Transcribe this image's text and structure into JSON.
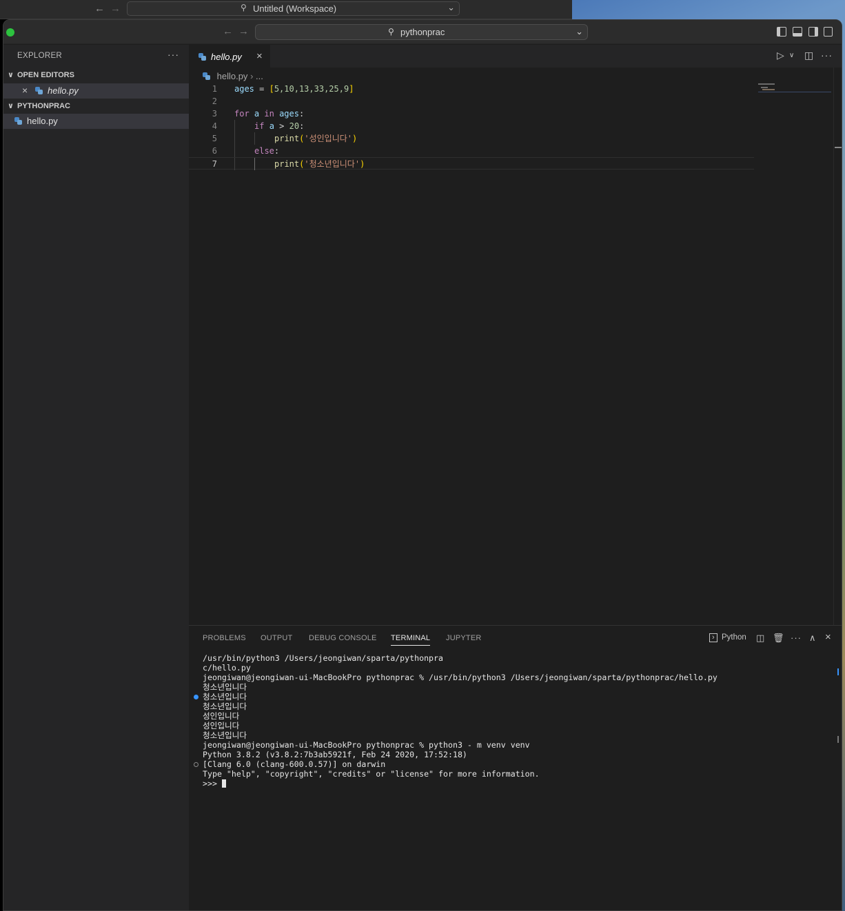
{
  "background_window": {
    "search_text": "Untitled (Workspace)"
  },
  "titlebar": {
    "search_text": "pythonprac"
  },
  "sidebar": {
    "header": "EXPLORER",
    "more": "···",
    "open_editors_label": "OPEN EDITORS",
    "open_editor_file": "hello.py",
    "project_label": "PYTHONPRAC",
    "project_file": "hello.py"
  },
  "editor": {
    "tab_label": "hello.py",
    "breadcrumb_file": "hello.py",
    "breadcrumb_rest": "...",
    "line_numbers": [
      "1",
      "2",
      "3",
      "4",
      "5",
      "6",
      "7"
    ],
    "code": {
      "l1_var": "ages",
      "l1_eq": " = ",
      "l1_open": "[",
      "l1_nums": "5,10,13,33,25,9",
      "l1_close": "]",
      "l3_for": "for",
      "l3_a": "a",
      "l3_in": "in",
      "l3_ages": "ages",
      "l3_colon": ":",
      "l4_if": "if",
      "l4_a": "a",
      "l4_gt": " > ",
      "l4_num": "20",
      "l4_colon": ":",
      "l5_fn": "print",
      "l5_str": "'성인입니다'",
      "l6_else": "else",
      "l6_colon": ":",
      "l7_fn": "print",
      "l7_str": "'청소년입니다'"
    }
  },
  "panel": {
    "tabs": [
      "PROBLEMS",
      "OUTPUT",
      "DEBUG CONSOLE",
      "TERMINAL",
      "JUPYTER"
    ],
    "active_tab": "TERMINAL",
    "shell_label": "Python",
    "terminal_lines": [
      "/usr/bin/python3 /Users/jeongiwan/sparta/pythonpra",
      "c/hello.py",
      "jeongiwan@jeongiwan-ui-MacBookPro pythonprac % /usr/bin/python3 /Users/jeongiwan/sparta/pythonprac/hello.py",
      "청소년입니다",
      "청소년입니다",
      "청소년입니다",
      "성인입니다",
      "성인입니다",
      "청소년입니다",
      "jeongiwan@jeongiwan-ui-MacBookPro pythonprac % python3 - m venv venv",
      "Python 3.8.2 (v3.8.2:7b3ab5921f, Feb 24 2020, 17:52:18)",
      "[Clang 6.0 (clang-600.0.57)] on darwin",
      "Type \"help\", \"copyright\", \"credits\" or \"license\" for more information.",
      ">>> "
    ]
  },
  "colors": {
    "accent_dot": "#3794ff",
    "traffic_green": "#2dc23f"
  }
}
